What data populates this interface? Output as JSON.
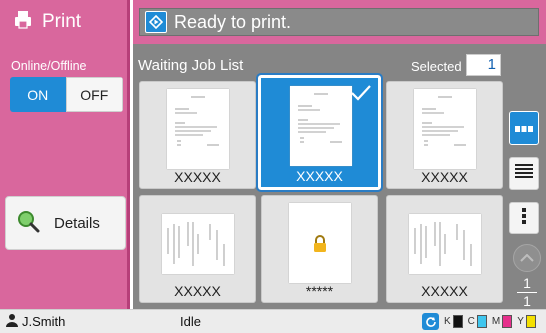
{
  "app": {
    "title": "Print",
    "icon": "printer-icon"
  },
  "status": {
    "text": "Ready to print.",
    "icon": "print-status-icon"
  },
  "online": {
    "label": "Online/Offline",
    "on_label": "ON",
    "off_label": "OFF",
    "selected": "ON"
  },
  "details": {
    "label": "Details",
    "icon": "magnifier-icon"
  },
  "job_list": {
    "title": "Waiting Job List",
    "selected_label": "Selected",
    "selected_count": "1",
    "jobs": [
      {
        "name": "XXXXX",
        "selected": false,
        "orientation": "portrait"
      },
      {
        "name": "XXXXX",
        "selected": true,
        "orientation": "portrait"
      },
      {
        "name": "XXXXX",
        "selected": false,
        "orientation": "portrait"
      },
      {
        "name": "XXXXX",
        "selected": false,
        "orientation": "landscape"
      },
      {
        "name": "*****",
        "selected": false,
        "locked": true
      },
      {
        "name": "XXXXX",
        "selected": false,
        "orientation": "landscape"
      }
    ]
  },
  "pager": {
    "current": "1",
    "total": "1"
  },
  "bottom": {
    "user": "J.Smith",
    "status": "Idle",
    "ink": [
      {
        "label": "K",
        "color": "#111111"
      },
      {
        "label": "C",
        "color": "#3fc6ee"
      },
      {
        "label": "M",
        "color": "#e6308c"
      },
      {
        "label": "Y",
        "color": "#f4e000"
      }
    ]
  },
  "colors": {
    "accent": "#1f8bd6",
    "sidebar": "#d9679d",
    "panel": "#858585"
  }
}
